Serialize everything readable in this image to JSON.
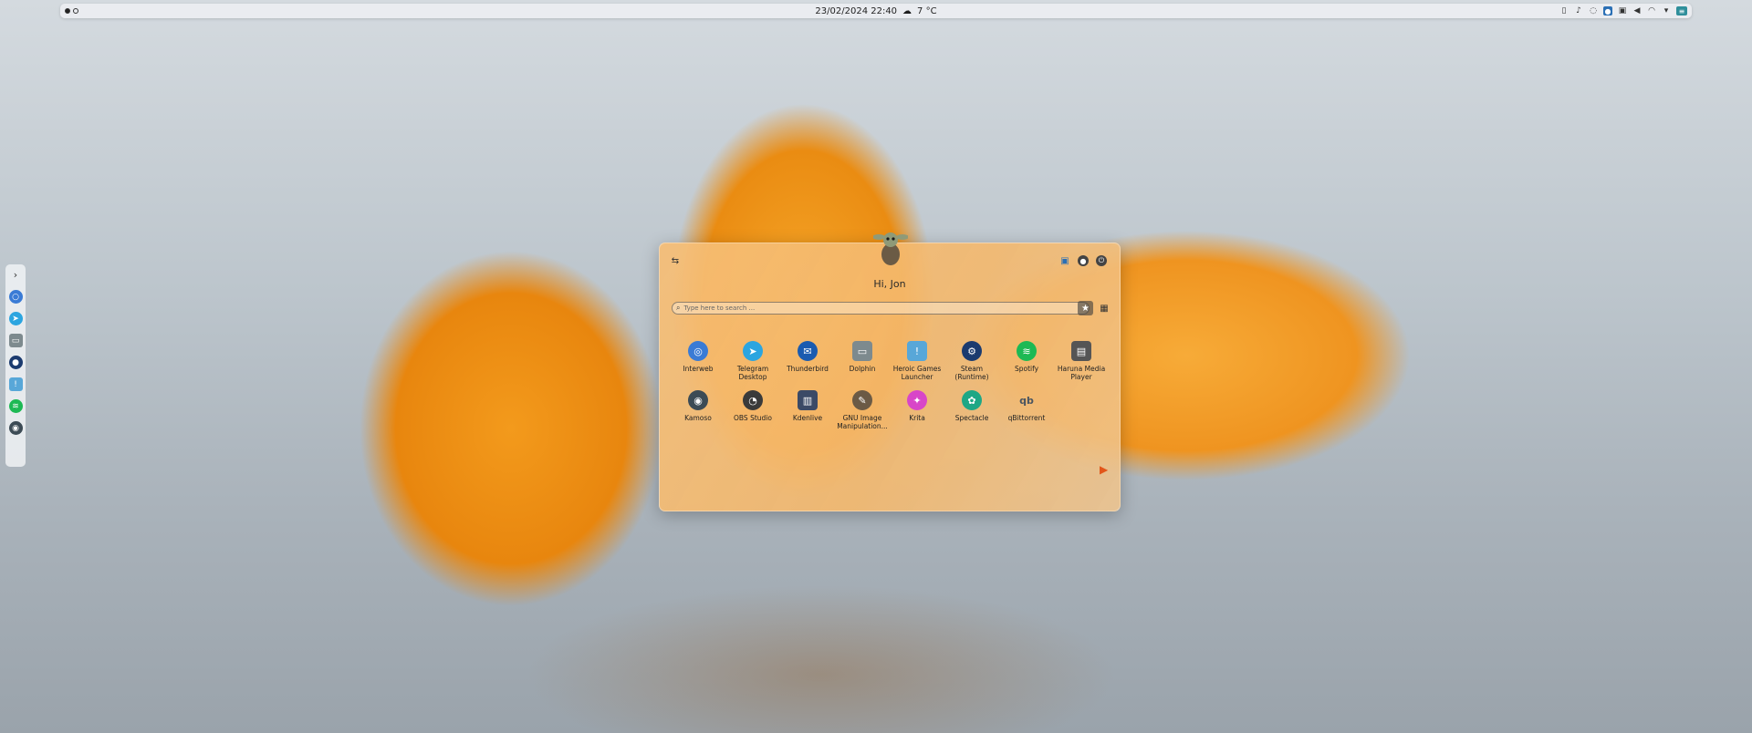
{
  "top_panel": {
    "datetime": "23/02/2024 22:40",
    "weather_icon": "cloud-night-icon",
    "temperature": "7 °C",
    "tray_icons": [
      "clipboard-icon",
      "activity-icon",
      "vpn-icon",
      "steam-icon",
      "display-icon",
      "volume-icon",
      "wifi-icon",
      "chevron-down-icon",
      "app-menu-icon"
    ]
  },
  "dock": {
    "items": [
      "launcher-icon",
      "chromium-icon",
      "telegram-icon",
      "dolphin-icon",
      "steam-icon",
      "heroic-icon",
      "spotify-icon",
      "kamoso-icon"
    ]
  },
  "launcher": {
    "greeting": "Hi, Jon",
    "search_placeholder": "Type here to search ...",
    "apps": [
      {
        "label": "Interweb",
        "icon": "chromium-icon",
        "color": "#3a7bd5"
      },
      {
        "label": "Telegram Desktop",
        "icon": "telegram-icon",
        "color": "#2ca5e0"
      },
      {
        "label": "Thunderbird",
        "icon": "thunderbird-icon",
        "color": "#1a5bb0"
      },
      {
        "label": "Dolphin",
        "icon": "dolphin-icon",
        "color": "#7d8a8e"
      },
      {
        "label": "Heroic Games Launcher",
        "icon": "heroic-icon",
        "color": "#58a7d8"
      },
      {
        "label": "Steam (Runtime)",
        "icon": "steam-icon",
        "color": "#1b3b6f"
      },
      {
        "label": "Spotify",
        "icon": "spotify-icon",
        "color": "#1db954"
      },
      {
        "label": "Haruna Media Player",
        "icon": "film-icon",
        "color": "#555555"
      },
      {
        "label": "Kamoso",
        "icon": "webcam-icon",
        "color": "#3c4b55"
      },
      {
        "label": "OBS Studio",
        "icon": "obs-icon",
        "color": "#3a3a3a"
      },
      {
        "label": "Kdenlive",
        "icon": "kdenlive-icon",
        "color": "#3b4a66"
      },
      {
        "label": "GNU Image Manipulation...",
        "icon": "gimp-icon",
        "color": "#6b5a45"
      },
      {
        "label": "Krita",
        "icon": "krita-icon",
        "color": "#d846c8"
      },
      {
        "label": "Spectacle",
        "icon": "spectacle-icon",
        "color": "#1ea785"
      },
      {
        "label": "qBittorrent",
        "icon": "qbittorrent-icon",
        "color": "#4a5560"
      }
    ]
  }
}
